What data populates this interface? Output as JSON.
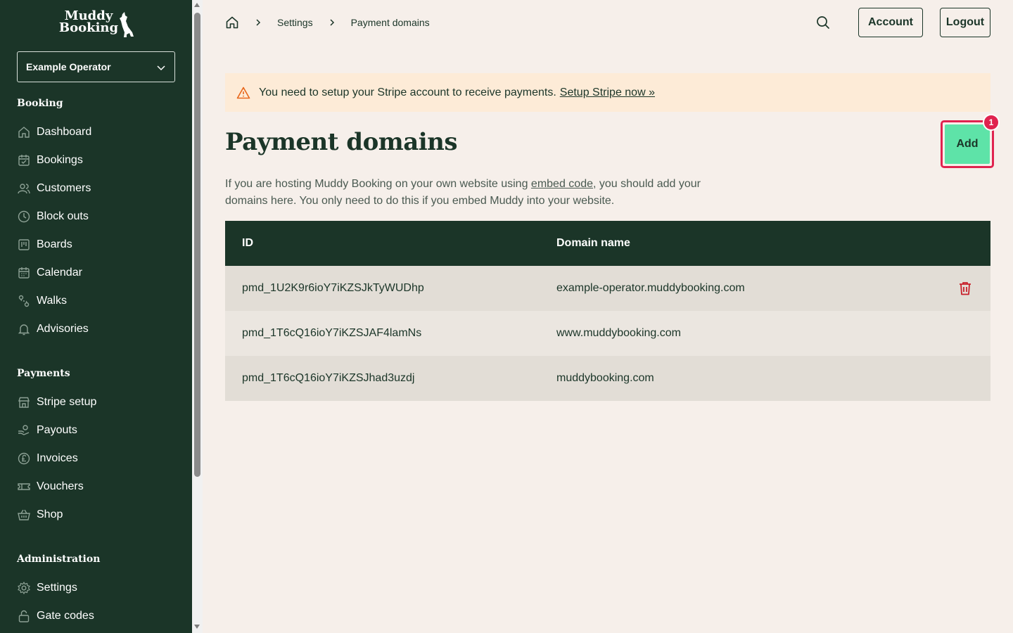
{
  "app": {
    "logo_text_line1": "Muddy",
    "logo_text_line2": "Booking",
    "operator": "Example Operator"
  },
  "sidebar": {
    "sections": [
      {
        "title": "Booking",
        "items": [
          "Dashboard",
          "Bookings",
          "Customers",
          "Block outs",
          "Boards",
          "Calendar",
          "Walks",
          "Advisories"
        ]
      },
      {
        "title": "Payments",
        "items": [
          "Stripe setup",
          "Payouts",
          "Invoices",
          "Vouchers",
          "Shop"
        ]
      },
      {
        "title": "Administration",
        "items": [
          "Settings",
          "Gate codes"
        ]
      }
    ]
  },
  "header": {
    "breadcrumb": [
      "Settings",
      "Payment domains"
    ],
    "account_label": "Account",
    "logout_label": "Logout"
  },
  "alert": {
    "message": "You need to setup your Stripe account to receive payments.",
    "link": "Setup Stripe now »"
  },
  "page": {
    "title": "Payment domains",
    "add_label": "Add",
    "badge": "1",
    "desc_part1": "If you are hosting Muddy Booking on your own website using ",
    "desc_link": "embed code",
    "desc_part2": ", you should add your domains here. You only need to do this if you embed Muddy into your website."
  },
  "table": {
    "headers": [
      "ID",
      "Domain name"
    ],
    "rows": [
      {
        "id": "pmd_1U2K9r6ioY7iKZSJkTyWUDhp",
        "domain": "example-operator.muddybooking.com"
      },
      {
        "id": "pmd_1T6cQ16ioY7iKZSJAF4lamNs",
        "domain": "www.muddybooking.com"
      },
      {
        "id": "pmd_1T6cQ16ioY7iKZSJhad3uzdj",
        "domain": "muddybooking.com"
      }
    ]
  },
  "colors": {
    "sidebar_bg": "#1b3528",
    "page_bg": "#f6efea",
    "accent_green": "#5ee3a8",
    "highlight_red": "#e0234f",
    "alert_bg": "#fdebd7"
  }
}
